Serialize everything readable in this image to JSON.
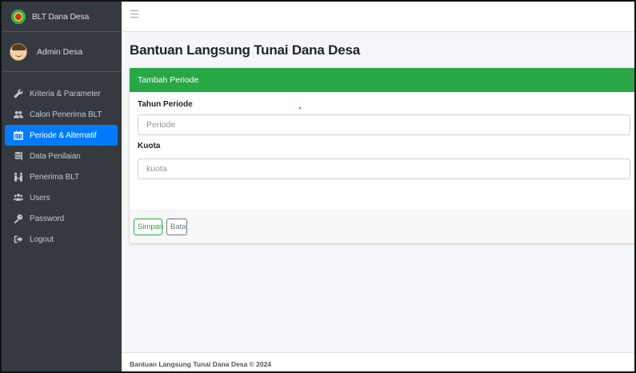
{
  "brand": {
    "name": "BLT Dana Desa",
    "logo_icon": "village-emblem-icon"
  },
  "user": {
    "name": "Admin Desa",
    "avatar_icon": "user-avatar-icon"
  },
  "sidebar": {
    "items": [
      {
        "label": "Kriteria & Parameter",
        "icon": "wrench-icon",
        "active": false
      },
      {
        "label": "Calon Penerima BLT",
        "icon": "users-icon",
        "active": false
      },
      {
        "label": "Periode & Alternatif",
        "icon": "calendar-icon",
        "active": true
      },
      {
        "label": "Data Penilaian",
        "icon": "database-icon",
        "active": false
      },
      {
        "label": "Penerima BLT",
        "icon": "people-arrows-icon",
        "active": false
      },
      {
        "label": "Users",
        "icon": "users-cog-icon",
        "active": false
      },
      {
        "label": "Password",
        "icon": "key-icon",
        "active": false
      },
      {
        "label": "Logout",
        "icon": "sign-out-icon",
        "active": false
      }
    ]
  },
  "topbar": {
    "menu_icon": "hamburger-icon"
  },
  "page": {
    "title": "Bantuan Langsung Tunai Dana Desa"
  },
  "form": {
    "header": "Tambah Periode",
    "period_label": "Tahun Periode",
    "period_placeholder": "Periode",
    "quota_label": "Kuota",
    "quota_placeholder": "kuota",
    "save_label": "Simpan",
    "cancel_label": "Batal"
  },
  "footer": {
    "text": "Bantuan Langsung Tunai Dana Desa © 2024"
  },
  "colors": {
    "sidebar_bg": "#343a40",
    "active": "#007bff",
    "success": "#28a745"
  }
}
